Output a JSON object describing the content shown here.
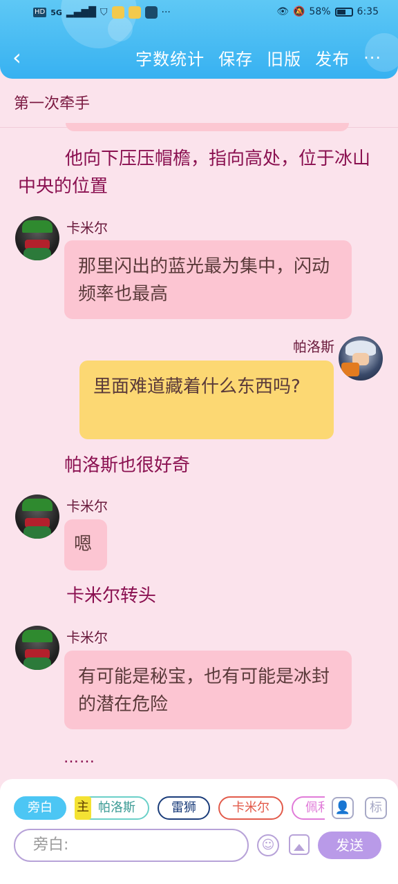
{
  "status_bar": {
    "net_hd": "HD",
    "net_5g": "5G",
    "battery": "58%",
    "time": "6:35",
    "more": "···"
  },
  "toolbar": {
    "back_icon": "chevron-left-icon",
    "word_count": "字数统计",
    "save": "保存",
    "old_version": "旧版",
    "publish": "发布",
    "more": "···"
  },
  "story_title": "第一次牵手",
  "messages": {
    "narr1": "他向下压压帽檐，指向高处，位于冰山中央的位置",
    "m1_name": "卡米尔",
    "m1_text": "那里闪出的蓝光最为集中，闪动频率也最高",
    "m2_name": "帕洛斯",
    "m2_text": "里面难道藏着什么东西吗?",
    "narr2": "帕洛斯也很好奇",
    "m3_name": "卡米尔",
    "m3_text": "嗯",
    "narr3": "卡米尔转头",
    "m4_name": "卡米尔",
    "m4_text": "有可能是秘宝，也有可能是冰封的潜在危险",
    "ellipsis": "……"
  },
  "composer": {
    "chips": [
      "旁白",
      "帕洛斯",
      "雷狮",
      "卡米尔",
      "佩利"
    ],
    "main_tag": "主",
    "tag_label": "标",
    "placeholder": "旁白:",
    "send": "发送"
  },
  "colors": {
    "header": "#37b1f1",
    "background": "#fbe3ec",
    "bubble_pink": "#fcc5d2",
    "bubble_yellow": "#fcd873",
    "narration": "#8a1050",
    "send": "#b99ae8"
  }
}
